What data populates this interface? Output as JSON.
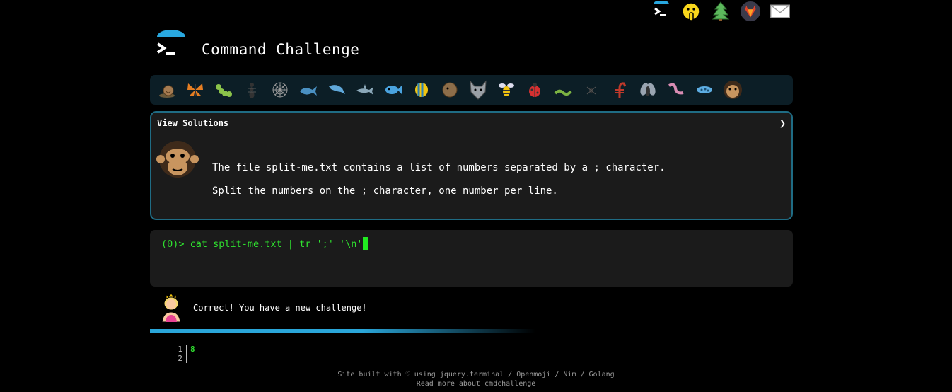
{
  "header": {
    "title": "Command Challenge"
  },
  "top_icons": [
    "cmd-logo-icon",
    "shushing-face-icon",
    "tree-icon",
    "gitlab-icon",
    "envelope-icon"
  ],
  "emoji_bar": {
    "icons": [
      "snail-icon",
      "butterfly-icon",
      "caterpillar-icon",
      "ant-icon",
      "spider-web-icon",
      "whale-icon",
      "dolphin-icon",
      "shark-icon",
      "fish-icon",
      "tropical-fish-icon",
      "pufferfish-icon",
      "wolf-icon",
      "bee-icon",
      "ladybug-icon",
      "worm-icon",
      "spider-icon",
      "scorpion-icon",
      "fly-icon",
      "earthworm-icon",
      "microbe-icon",
      "chimpanzee-icon"
    ]
  },
  "challenge": {
    "view_solutions": "View Solutions",
    "chevron": "❯",
    "line1": "The file split-me.txt contains a list of numbers separated by a ; character.",
    "line2": "Split the numbers on the ; character, one number per line."
  },
  "terminal": {
    "prompt": "(0)> ",
    "command": "cat split-me.txt | tr ';' '\\n'"
  },
  "result": {
    "message": "Correct! You have a new challenge!",
    "progress": 0.6
  },
  "output": {
    "lines": [
      {
        "num": "1",
        "text": "8"
      },
      {
        "num": "2",
        "text": ""
      }
    ]
  },
  "footer": {
    "line1": "Site built with ♡ using jquery.terminal / Openmoji / Nim / Golang",
    "line2": "Read more about cmdchallenge"
  },
  "colors": {
    "accent": "#2aa6d9",
    "terminal_green": "#2fe02f",
    "border": "#1f6c84"
  }
}
